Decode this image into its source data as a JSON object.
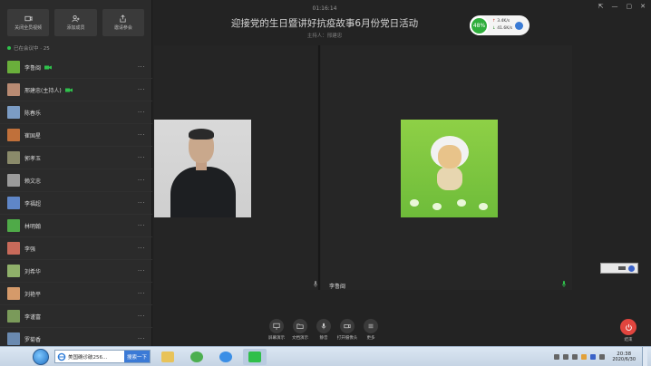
{
  "sidebar": {
    "actions": [
      {
        "label": "关闭全员视频"
      },
      {
        "label": "添加成员"
      },
      {
        "label": "邀请参会"
      }
    ],
    "count_label": "已在会议中 · 25",
    "participants": [
      {
        "name": "李鲁闽",
        "video": true,
        "avatar_color": "#6aaf3b"
      },
      {
        "name": "邢建忠(主持人)",
        "video": true,
        "avatar_color": "#b88a72"
      },
      {
        "name": "陈春乐",
        "video": false,
        "avatar_color": "#7b9cc4"
      },
      {
        "name": "崔国星",
        "video": false,
        "avatar_color": "#c0703a"
      },
      {
        "name": "郭孝玉",
        "video": false,
        "avatar_color": "#8a8a6a"
      },
      {
        "name": "赖文忠",
        "video": false,
        "avatar_color": "#9a9a9a"
      },
      {
        "name": "李福超",
        "video": false,
        "avatar_color": "#5f86c7"
      },
      {
        "name": "林明翰",
        "video": false,
        "avatar_color": "#4faa48"
      },
      {
        "name": "李强",
        "video": false,
        "avatar_color": "#c86a5a"
      },
      {
        "name": "刘希华",
        "video": false,
        "avatar_color": "#8fb06a"
      },
      {
        "name": "刘艳平",
        "video": false,
        "avatar_color": "#d59a6a"
      },
      {
        "name": "李谨富",
        "video": false,
        "avatar_color": "#7a9a5a"
      },
      {
        "name": "罗菊香",
        "video": false,
        "avatar_color": "#6a8ab0"
      }
    ]
  },
  "header": {
    "timer": "01:16:14",
    "title": "迎接党的生日暨讲好抗疫故事6月份党日活动",
    "host": "主持人：邢建忠"
  },
  "network": {
    "percent": "48%",
    "up": "3.4K/s",
    "down": "41.6K/s"
  },
  "video": {
    "right_tile_name": "李鲁闽"
  },
  "toolbar": {
    "items": [
      {
        "label": "屏幕演示"
      },
      {
        "label": "文档演示"
      },
      {
        "label": "静音"
      },
      {
        "label": "打开摄像头"
      },
      {
        "label": "更多"
      }
    ],
    "hangup_label": "结束"
  },
  "taskbar": {
    "search_text": "美国确诊破256...",
    "search_button": "搜索一下",
    "time": "20:38",
    "date": "2020/6/30"
  },
  "colors": {
    "accent_green": "#2fc24c",
    "hangup_red": "#e1453e"
  }
}
